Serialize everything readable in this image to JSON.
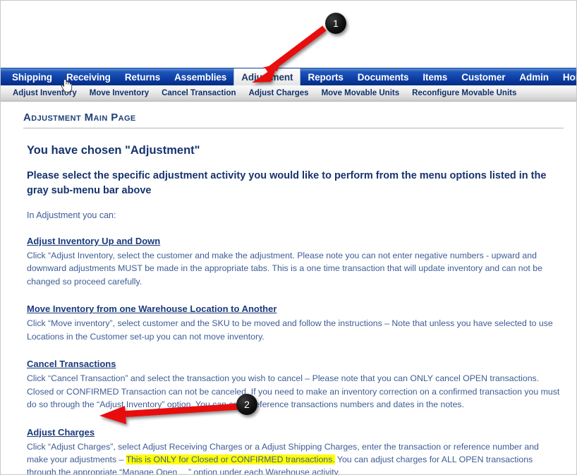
{
  "nav": {
    "items": [
      {
        "label": "Shipping",
        "active": false
      },
      {
        "label": "Receiving",
        "active": false
      },
      {
        "label": "Returns",
        "active": false
      },
      {
        "label": "Assemblies",
        "active": false
      },
      {
        "label": "Adjustment",
        "active": true
      },
      {
        "label": "Reports",
        "active": false
      },
      {
        "label": "Documents",
        "active": false
      },
      {
        "label": "Items",
        "active": false
      },
      {
        "label": "Customer",
        "active": false
      },
      {
        "label": "Admin",
        "active": false
      },
      {
        "label": "Home",
        "active": false
      }
    ]
  },
  "subnav": {
    "items": [
      {
        "label": "Adjust Inventory"
      },
      {
        "label": "Move Inventory"
      },
      {
        "label": "Cancel Transaction"
      },
      {
        "label": "Adjust Charges"
      },
      {
        "label": "Move Movable Units"
      },
      {
        "label": "Reconfigure Movable Units"
      }
    ]
  },
  "page": {
    "title": "Adjustment Main Page",
    "chosen_heading": "You have chosen \"Adjustment\"",
    "instruction": "Please select the specific adjustment activity you would like to perform from the menu options listed in the gray sub-menu bar above",
    "lead": "In Adjustment you can:"
  },
  "sections": [
    {
      "link": "Adjust Inventory Up and Down",
      "body": "Click “Adjust Inventory, select the customer and make the adjustment. Please note you can not enter negative numbers - upward and downward adjustments MUST be made in the appropriate tabs. This is a one time transaction that will update inventory and can not be changed so proceed carefully."
    },
    {
      "link": "Move Inventory from one Warehouse Location to Another",
      "body": "Click “Move inventory”, select customer and the SKU to be moved and follow the instructions – Note that unless you have selected to use Locations in the Customer set-up you can not move inventory."
    },
    {
      "link": "Cancel Transactions",
      "body": "Click “Cancel Transaction” and select the transaction you wish to cancel – Please note that you can ONLY cancel OPEN transactions. Closed or CONFIRMED Transaction can not be canceled. If you need to make an inventory correction on a confirmed transaction you must do so through the “Adjust Inventory” option. You can cross reference transactions numbers and dates in the notes."
    },
    {
      "link": "Adjust Charges",
      "body_before": "Click “Adjust Charges”, select Adjust Receiving Charges or a Adjust Shipping Charges, enter the transaction or reference number and make your adjustments – ",
      "body_highlight": "This is ONLY for Closed or CONFIRMED transactions.",
      "body_after": " You can adjust charges for ALL OPEN transactions through the appropriate “Manage Open …” option under each Warehouse activity."
    }
  ],
  "annotations": {
    "markers": [
      {
        "label": "1"
      },
      {
        "label": "2"
      }
    ],
    "arrow_color": "#e81010"
  },
  "colors": {
    "nav_blue": "#0c3ea6",
    "link_navy": "#1a3a7d",
    "body_blue": "#3d5c95",
    "highlight_yellow": "#ffff00",
    "marker_black": "#000000"
  }
}
